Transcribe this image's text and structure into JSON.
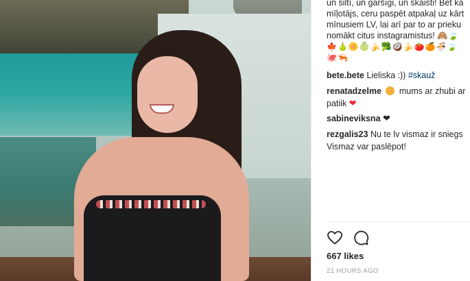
{
  "post": {
    "caption_lines": [
      "un siltī, un garšīgi, un skaisti! Bet kā",
      "mīļotājs, ceru paspēt atpakaļ uz kārt",
      "mīnusiem LV, lai arī par to ar prieku",
      "nomākt citus instagramistus! 🙈🍃",
      "🍁🍐🌼🍈🍌🥦🥥🍌🍅🍊🍜🍃",
      "🐙🦐"
    ],
    "likes": "667 likes",
    "time_ago": "21 HOURS AGO"
  },
  "comments": [
    {
      "user": "bete.bete",
      "text": "Lieliska :))",
      "tag": "#skauž"
    },
    {
      "user": "renatadzelme",
      "text": "mums ar zhubi ar",
      "text2": "patiik",
      "emoji": "smiley-face",
      "heart": "red-heart"
    },
    {
      "user": "sabineviksna",
      "heart": "black-heart"
    },
    {
      "user": "rezgalis23",
      "text": "Nu te lv vismaz ir sniegs",
      "text2": "Vismaz var paslēpot!"
    }
  ],
  "icons": {
    "like": "heart-outline-icon",
    "comment": "speech-bubble-icon"
  },
  "colors": {
    "text": "#262626",
    "hashtag": "#003569",
    "muted": "#999999",
    "heart_red": "#ed2a3a"
  }
}
